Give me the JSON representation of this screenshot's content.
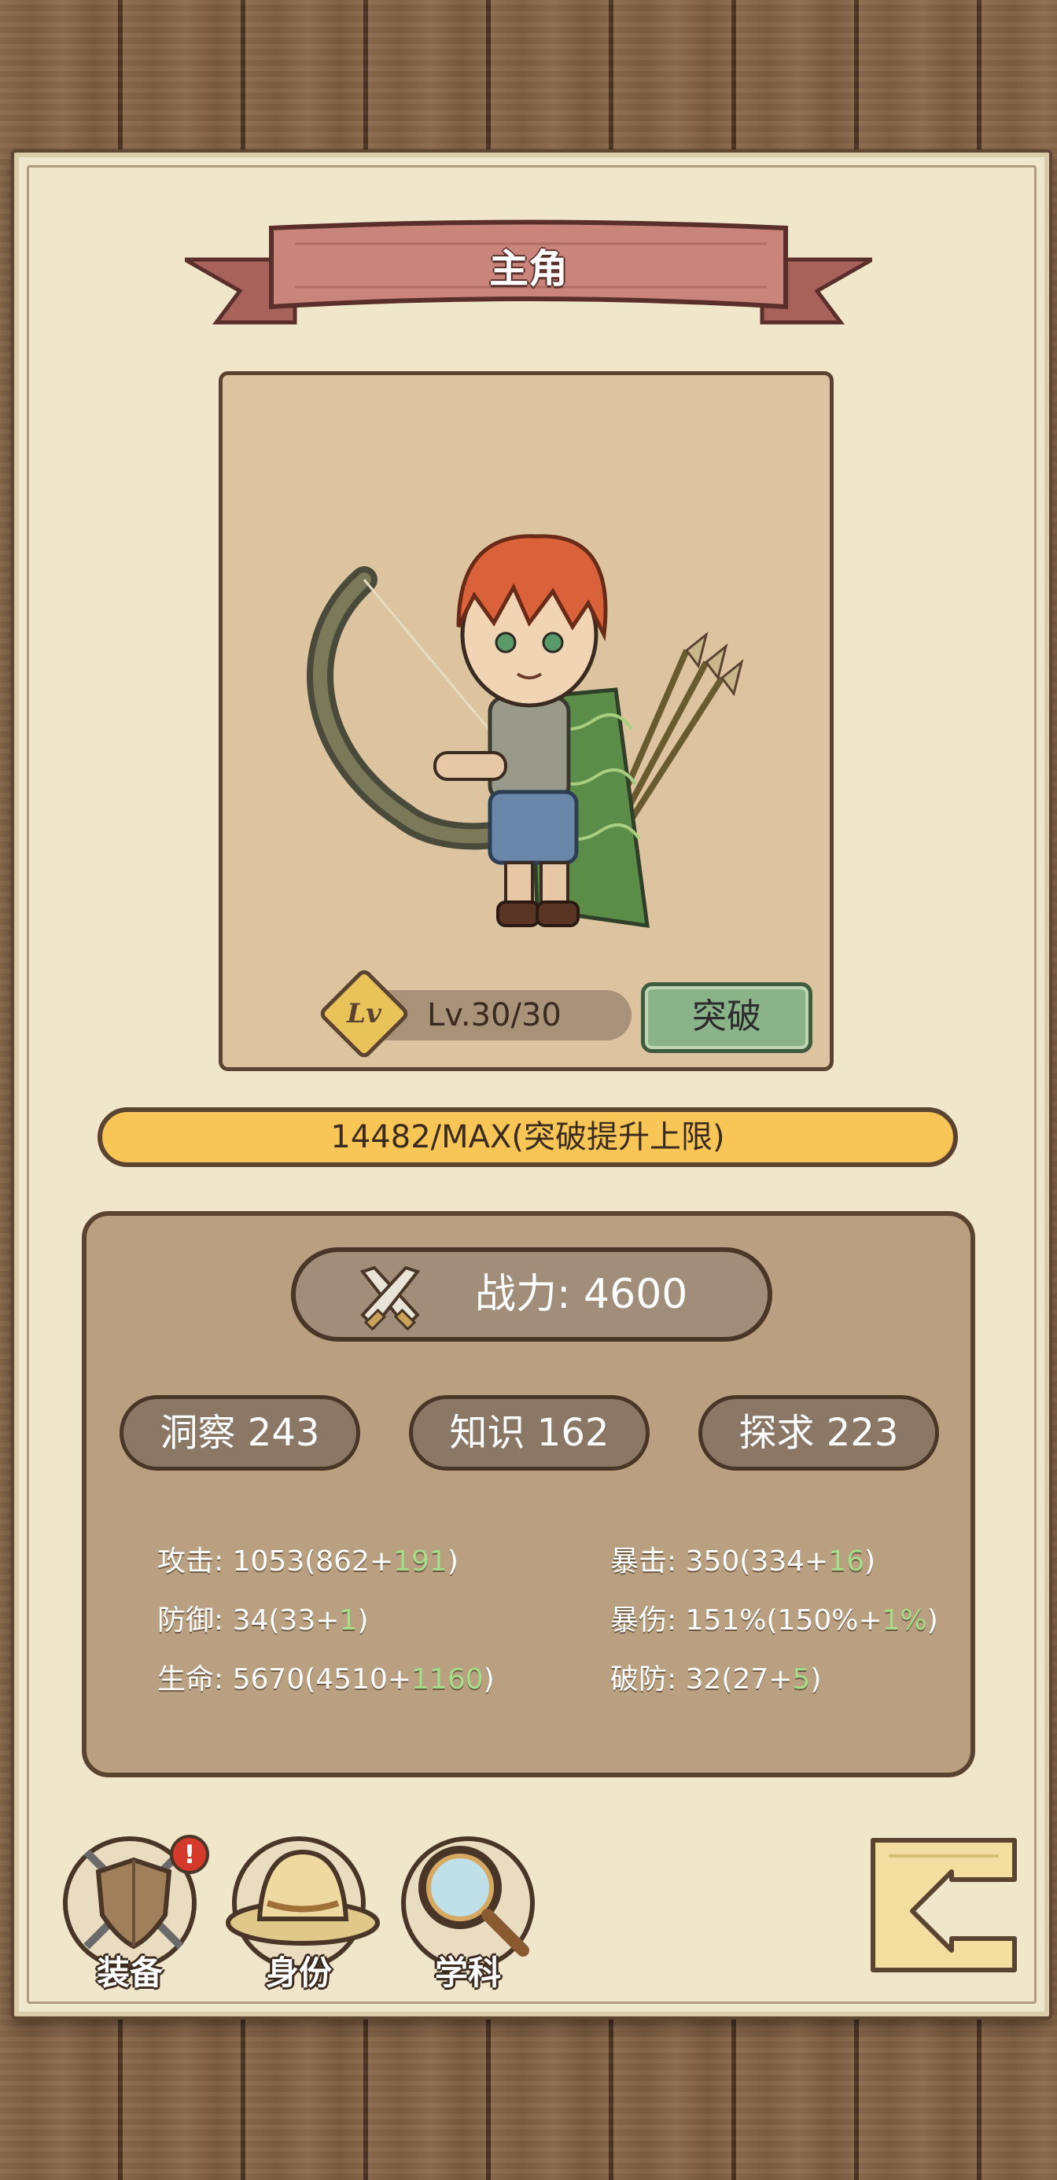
{
  "header": {
    "title": "主角"
  },
  "hero": {
    "level_badge": "Lv",
    "level_text": "Lv.30/30",
    "breakthrough_label": "突破"
  },
  "exp": {
    "text": "14482/MAX(突破提升上限)"
  },
  "power": {
    "text": "战力: 4600"
  },
  "attributes": [
    {
      "label": "洞察 243"
    },
    {
      "label": "知识 162"
    },
    {
      "label": "探求 223"
    }
  ],
  "stats": {
    "attack": {
      "prefix": "攻击: 1053(862+",
      "bonus": "191",
      "suffix": ")"
    },
    "defense": {
      "prefix": "防御: 34(33+",
      "bonus": "1",
      "suffix": ")"
    },
    "hp": {
      "prefix": "生命: 5670(4510+",
      "bonus": "1160",
      "suffix": ")"
    },
    "crit": {
      "prefix": "暴击: 350(334+",
      "bonus": "16",
      "suffix": ")"
    },
    "crit_dmg": {
      "prefix": "暴伤: 151%(150%+",
      "bonus": "1%",
      "suffix": ")"
    },
    "armor_pen": {
      "prefix": "破防: 32(27+",
      "bonus": "5",
      "suffix": ")"
    }
  },
  "nav": {
    "equipment": {
      "label": "装备",
      "icon": "shield-swords-icon",
      "badge": "!"
    },
    "identity": {
      "label": "身份",
      "icon": "hat-icon"
    },
    "subject": {
      "label": "学科",
      "icon": "magnifier-icon"
    },
    "back": {
      "icon": "back-arrow-icon"
    }
  },
  "colors": {
    "paper": "#efe6cb",
    "banner": "#c9857c",
    "exp_bar": "#f7c656",
    "button_green": "#8ab38a",
    "bonus_green": "#a6dd8c",
    "alert_red": "#d33a2c"
  }
}
